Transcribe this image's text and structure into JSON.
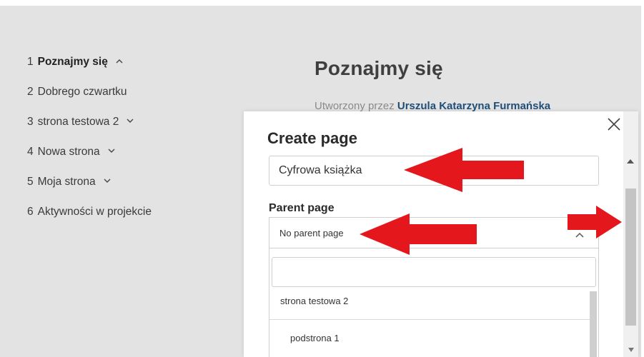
{
  "sidebar": {
    "items": [
      {
        "num": "1",
        "label": "Poznajmy się",
        "chevron": "up"
      },
      {
        "num": "2",
        "label": "Dobrego czwartku",
        "chevron": ""
      },
      {
        "num": "3",
        "label": "strona testowa 2",
        "chevron": "down"
      },
      {
        "num": "4",
        "label": "Nowa strona",
        "chevron": "down"
      },
      {
        "num": "5",
        "label": "Moja strona",
        "chevron": "down"
      },
      {
        "num": "6",
        "label": "Aktywności w projekcie",
        "chevron": ""
      }
    ]
  },
  "main": {
    "title": "Poznajmy się",
    "created_prefix": "Utworzony przez",
    "author": "Urszula Katarzyna Furmańska"
  },
  "modal": {
    "title": "Create page",
    "close_icon": "close-icon",
    "page_name_value": "Cyfrowa książka",
    "parent_label": "Parent page",
    "parent_selected": "No parent page",
    "search_value": "",
    "options": [
      "strona testowa 2",
      "podstrona 1"
    ]
  },
  "colors": {
    "background": "#e3e3e3",
    "author_link": "#1f4e79",
    "annotation_arrow": "#e4171c"
  }
}
